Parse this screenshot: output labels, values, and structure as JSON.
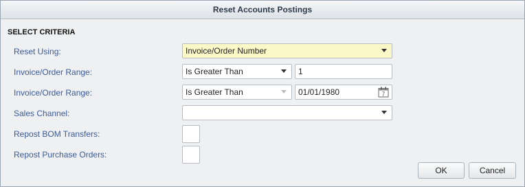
{
  "dialog": {
    "title": "Reset Accounts Postings",
    "section_title": "SELECT CRITERIA"
  },
  "fields": {
    "reset_using": {
      "label": "Reset Using:",
      "value": "Invoice/Order Number"
    },
    "range1": {
      "label": "Invoice/Order Range:",
      "operator": "Is Greater Than",
      "value": "1"
    },
    "range2": {
      "label": "Invoice/Order Range:",
      "operator": "Is Greater Than",
      "value": "01/01/1980"
    },
    "sales_channel": {
      "label": "Sales Channel:",
      "value": ""
    },
    "repost_bom": {
      "label": "Repost BOM Transfers:",
      "checked": false
    },
    "repost_po": {
      "label": "Repost Purchase Orders:",
      "checked": false
    }
  },
  "buttons": {
    "ok_label": "OK",
    "cancel_label": "Cancel"
  },
  "icons": {
    "calendar": "calendar-icon",
    "dropdown": "chevron-down-icon"
  },
  "colors": {
    "label": "#3b5a95",
    "highlight_field": "#fbf8c8",
    "titlebar_text": "#2d3a48"
  }
}
